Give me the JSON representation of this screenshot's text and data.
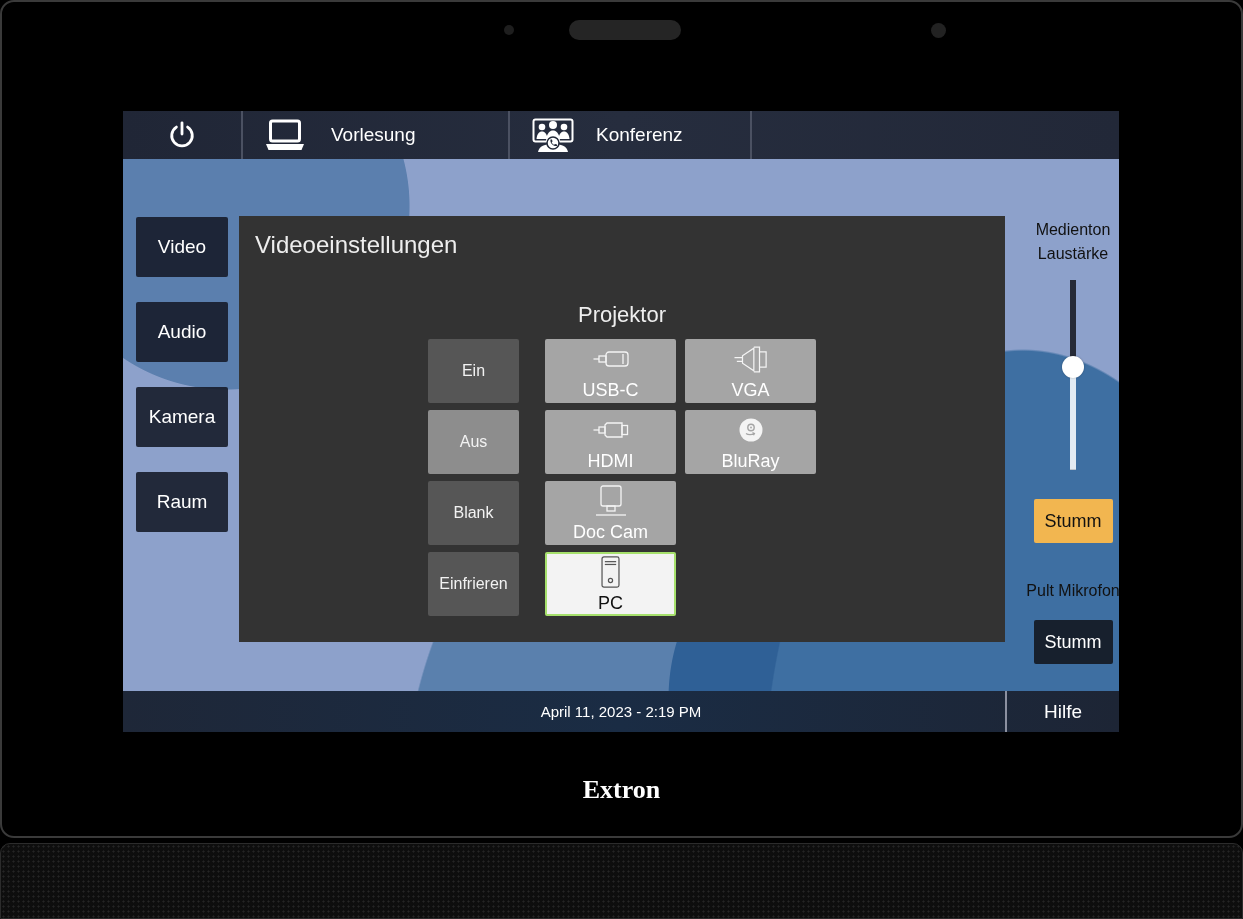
{
  "device": {
    "brand": "Extron"
  },
  "top_bar": {
    "modes": [
      {
        "label": "Vorlesung"
      },
      {
        "label": "Konferenz"
      }
    ]
  },
  "nav": {
    "items": [
      {
        "label": "Video"
      },
      {
        "label": "Audio"
      },
      {
        "label": "Kamera"
      },
      {
        "label": "Raum"
      }
    ]
  },
  "dialog": {
    "title": "Videoeinstellungen",
    "section": "Projektor",
    "power_controls": [
      {
        "label": "Ein",
        "selected": false
      },
      {
        "label": "Aus",
        "selected": true
      },
      {
        "label": "Blank",
        "selected": false
      },
      {
        "label": "Einfrieren",
        "selected": false
      }
    ],
    "source_columns": [
      {
        "sources": [
          {
            "label": "USB-C",
            "kind": "usbc",
            "selected": false
          },
          {
            "label": "HDMI",
            "kind": "hdmi",
            "selected": false
          },
          {
            "label": "Doc Cam",
            "kind": "doccam",
            "selected": false
          },
          {
            "label": "PC",
            "kind": "computer",
            "selected": true
          }
        ]
      },
      {
        "sources": [
          {
            "label": "VGA",
            "kind": "vga",
            "selected": false
          },
          {
            "label": "BluRay",
            "kind": "disc",
            "selected": false
          }
        ]
      }
    ]
  },
  "audio_panel": {
    "volume_label": "Medienton Laustärke",
    "volume": {
      "level": 0.54
    },
    "volume_mute": {
      "label": "Stumm",
      "on": true
    },
    "mic_label": "Pult Mikrofon",
    "mic_mute": {
      "label": "Stumm",
      "on": false
    }
  },
  "status_bar": {
    "datetime": "April 11, 2023 - 2:19 PM",
    "help": "Hilfe"
  }
}
